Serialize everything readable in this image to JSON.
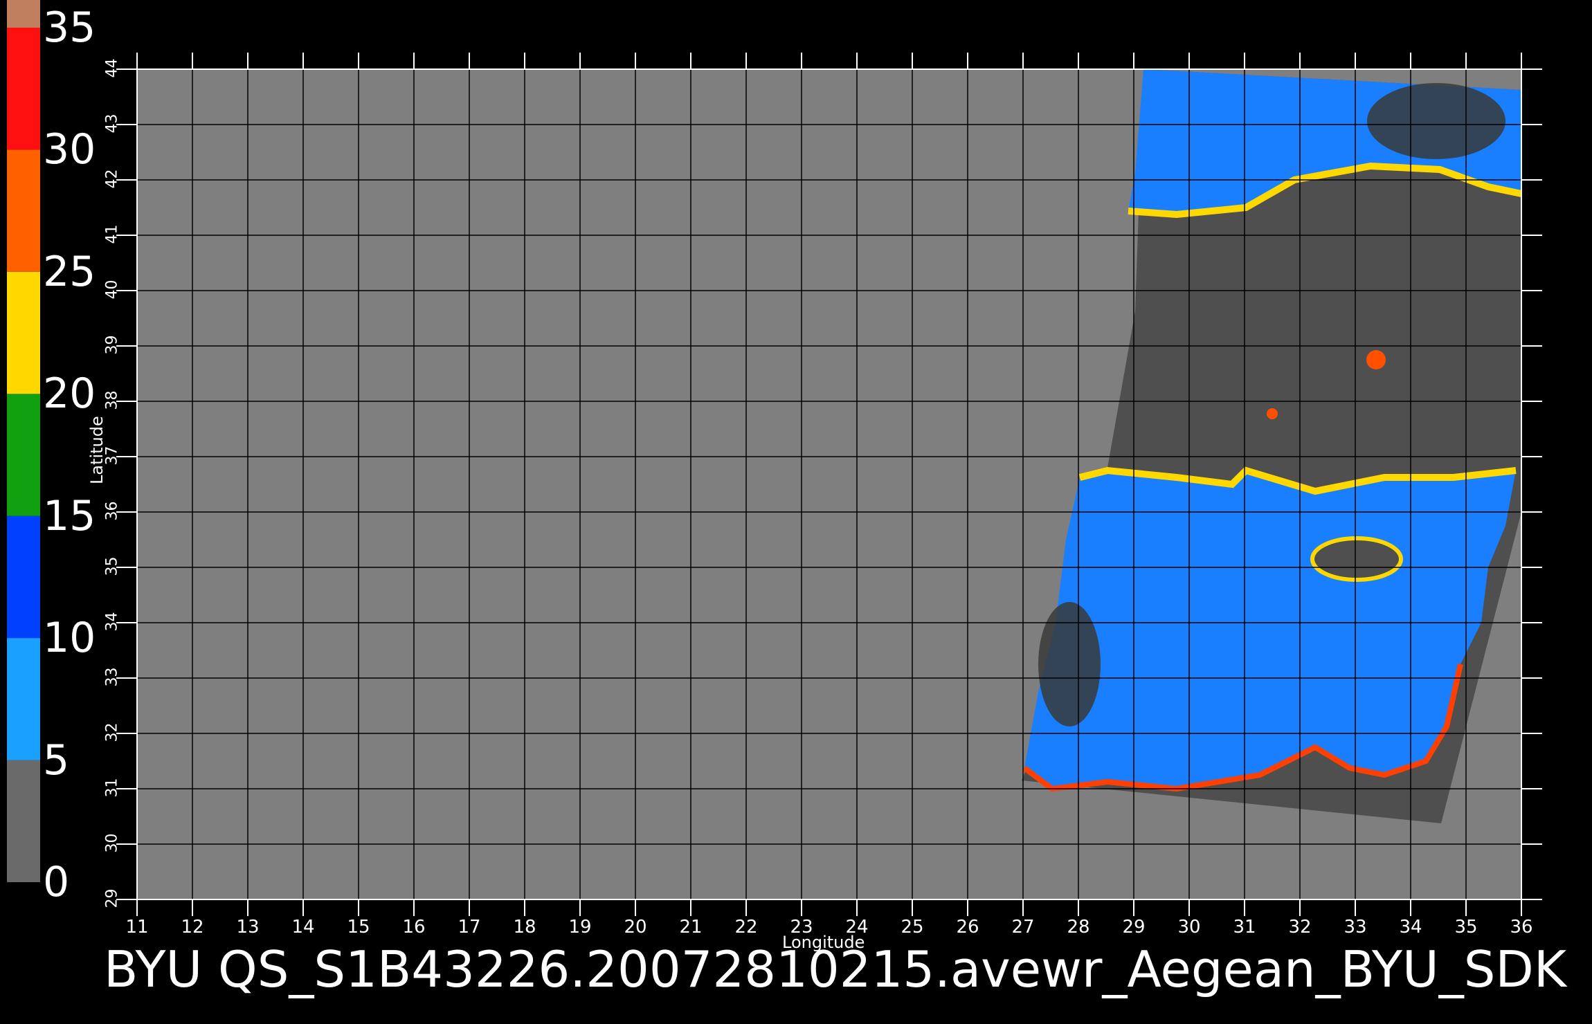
{
  "caption": "BYU  QS_S1B43226.20072810215.avewr_Aegean_BYU_SDK",
  "axes": {
    "xlabel": "Longitude",
    "ylabel": "Latitude",
    "lon_range": [
      11,
      36
    ],
    "lat_range": [
      29,
      44
    ],
    "lon_ticks": [
      "11",
      "12",
      "13",
      "14",
      "15",
      "16",
      "17",
      "18",
      "19",
      "20",
      "21",
      "22",
      "23",
      "24",
      "25",
      "26",
      "27",
      "28",
      "29",
      "30",
      "31",
      "32",
      "33",
      "34",
      "35",
      "36"
    ],
    "lat_ticks": [
      "29",
      "30",
      "31",
      "32",
      "33",
      "34",
      "35",
      "36",
      "37",
      "38",
      "39",
      "40",
      "41",
      "42",
      "43",
      "44"
    ],
    "grid": true
  },
  "colorbar": {
    "ticks": [
      "0",
      "5",
      "10",
      "15",
      "20",
      "25",
      "30",
      "35"
    ],
    "range": [
      0,
      35
    ],
    "segments": [
      {
        "from": 0,
        "to": 5,
        "color": "#6a6a6a"
      },
      {
        "from": 5,
        "to": 10,
        "color": "#1aa0ff"
      },
      {
        "from": 10,
        "to": 15,
        "color": "#0040ff"
      },
      {
        "from": 15,
        "to": 20,
        "color": "#10a010"
      },
      {
        "from": 20,
        "to": 25,
        "color": "#ffd800"
      },
      {
        "from": 25,
        "to": 30,
        "color": "#ff6000"
      },
      {
        "from": 30,
        "to": 35,
        "color": "#ff1010"
      }
    ],
    "top_color": "#c08060"
  },
  "colors": {
    "background": "#000000",
    "land": "#7f7f7f",
    "swath": "#4f4f4f",
    "sea": "#1a7fff",
    "grid": "#000000"
  }
}
